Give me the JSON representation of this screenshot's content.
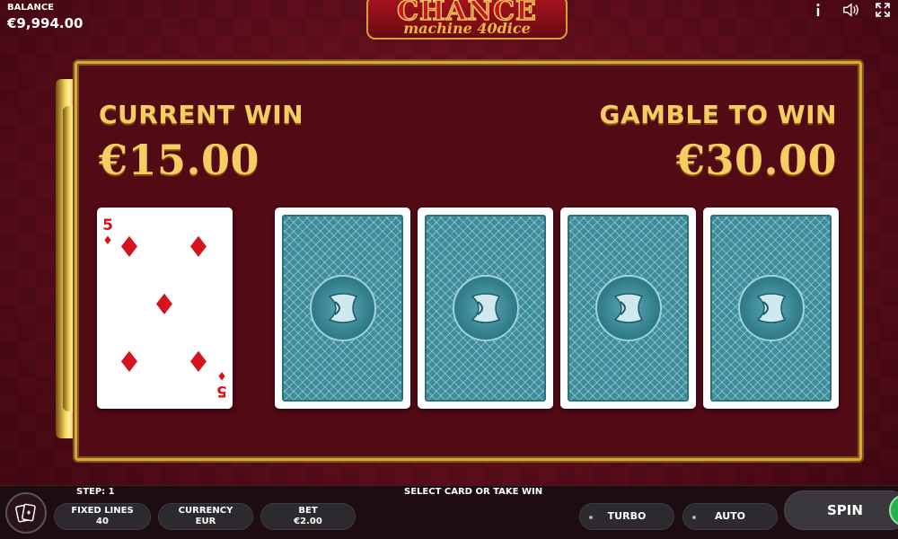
{
  "balance": {
    "label": "BALANCE",
    "value": "€9,994.00"
  },
  "logo": {
    "title": "CHANCE",
    "subtitle": "machine 40dice"
  },
  "top_icons": [
    "info-icon",
    "sound-icon",
    "fullscreen-icon"
  ],
  "gamble": {
    "current_win_label": "CURRENT WIN",
    "current_win_value": "€15.00",
    "gamble_to_win_label": "GAMBLE TO WIN",
    "gamble_to_win_value": "€30.00"
  },
  "dealer_card": {
    "rank": "5",
    "suit": "♦",
    "suit_name": "diamonds",
    "color": "#d5141d"
  },
  "face_down_cards": 4,
  "bottom": {
    "step": "STEP: 1",
    "status": "SELECT CARD OR TAKE WIN",
    "fixed_lines": {
      "label": "FIXED LINES",
      "value": "40"
    },
    "currency": {
      "label": "CURRENCY",
      "value": "EUR"
    },
    "bet": {
      "label": "BET",
      "value": "€2.00"
    },
    "turbo_label": "TURBO",
    "auto_label": "AUTO",
    "spin_label": "SPIN"
  },
  "colors": {
    "gold": "#f6cd63",
    "background": "#5c0d1b",
    "card_back": "#3d8e9c",
    "spin_green": "#21b24a"
  }
}
